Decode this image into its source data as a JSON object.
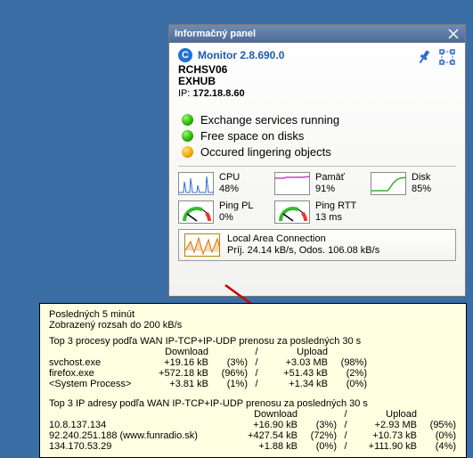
{
  "panel": {
    "title": "Informačný panel",
    "app_name": "Monitor 2.8.690.0",
    "host": "RCHSV06",
    "subhost": "EXHUB",
    "ip_label": "IP:",
    "ip_value": "172.18.8.60"
  },
  "status": [
    {
      "color": "green",
      "text": "Exchange services running"
    },
    {
      "color": "green",
      "text": "Free space on disks"
    },
    {
      "color": "orange",
      "text": "Occured lingering objects"
    }
  ],
  "metrics": {
    "cpu": {
      "name": "CPU",
      "value": "48%"
    },
    "mem": {
      "name": "Pamäť",
      "value": "91%"
    },
    "disk": {
      "name": "Disk",
      "value": "85%"
    },
    "pl": {
      "name": "Ping PL",
      "value": "0%"
    },
    "rtt": {
      "name": "Ping RTT",
      "value": "13 ms"
    }
  },
  "net": {
    "name": "Local Area Connection",
    "text": "Príj. 24.14 kB/s, Odos. 106.08 kB/s"
  },
  "tooltip": {
    "line1": "Posledných 5 minút",
    "line2": "Zobrazený rozsah do 200 kB/s",
    "proc_header": "Top 3 procesy podľa WAN IP-TCP+IP-UDP prenosu za posledných 30 s",
    "col_download": "Download",
    "col_upload": "Upload",
    "sep": "/",
    "procs": [
      {
        "name": "svchost.exe",
        "dl": "+19.16 kB",
        "dlp": "(3%)",
        "ul": "+3.03 MB",
        "ulp": "(98%)"
      },
      {
        "name": "firefox.exe",
        "dl": "+572.18 kB",
        "dlp": "(96%)",
        "ul": "+51.43 kB",
        "ulp": "(2%)"
      },
      {
        "name": "<System Process>",
        "dl": "+3.81 kB",
        "dlp": "(1%)",
        "ul": "+1.34 kB",
        "ulp": "(0%)"
      }
    ],
    "ip_header": "Top 3 IP adresy podľa WAN IP-TCP+IP-UDP prenosu za posledných 30 s",
    "ips": [
      {
        "name": "10.8.137.134",
        "dl": "+16.90 kB",
        "dlp": "(3%)",
        "ul": "+2.93 MB",
        "ulp": "(95%)"
      },
      {
        "name": "92.240.251.188 (www.funradio.sk)",
        "dl": "+427.54 kB",
        "dlp": "(72%)",
        "ul": "+10.73 kB",
        "ulp": "(0%)"
      },
      {
        "name": "134.170.53.29",
        "dl": "+1.88 kB",
        "dlp": "(0%)",
        "ul": "+111.90 kB",
        "ulp": "(4%)"
      }
    ]
  }
}
